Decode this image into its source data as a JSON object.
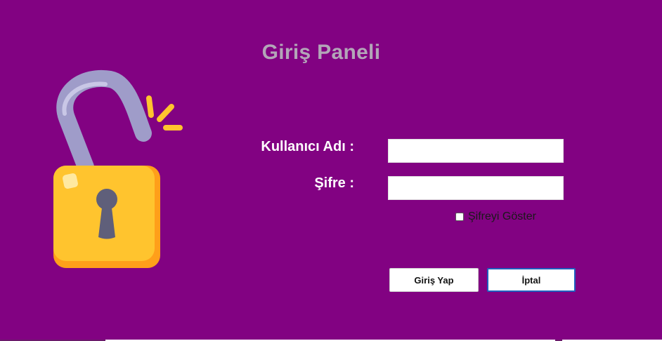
{
  "window": {
    "title": "Giriş Paneli",
    "background_color": "#820282"
  },
  "lock_image": {
    "icon": "open-padlock-icon",
    "body_color": "#ffc42e",
    "shackle_color": "#9f9cc9",
    "keyhole_color": "#5f5f7a",
    "spark_color": "#ffc42e"
  },
  "form": {
    "username_label": "Kullanıcı Adı :",
    "username_value": "",
    "password_label": "Şifre :",
    "password_value": "",
    "show_password_label": "Şifreyi Göster",
    "show_password_checked": false
  },
  "buttons": {
    "login_label": "Giriş Yap",
    "cancel_label": "İptal"
  }
}
